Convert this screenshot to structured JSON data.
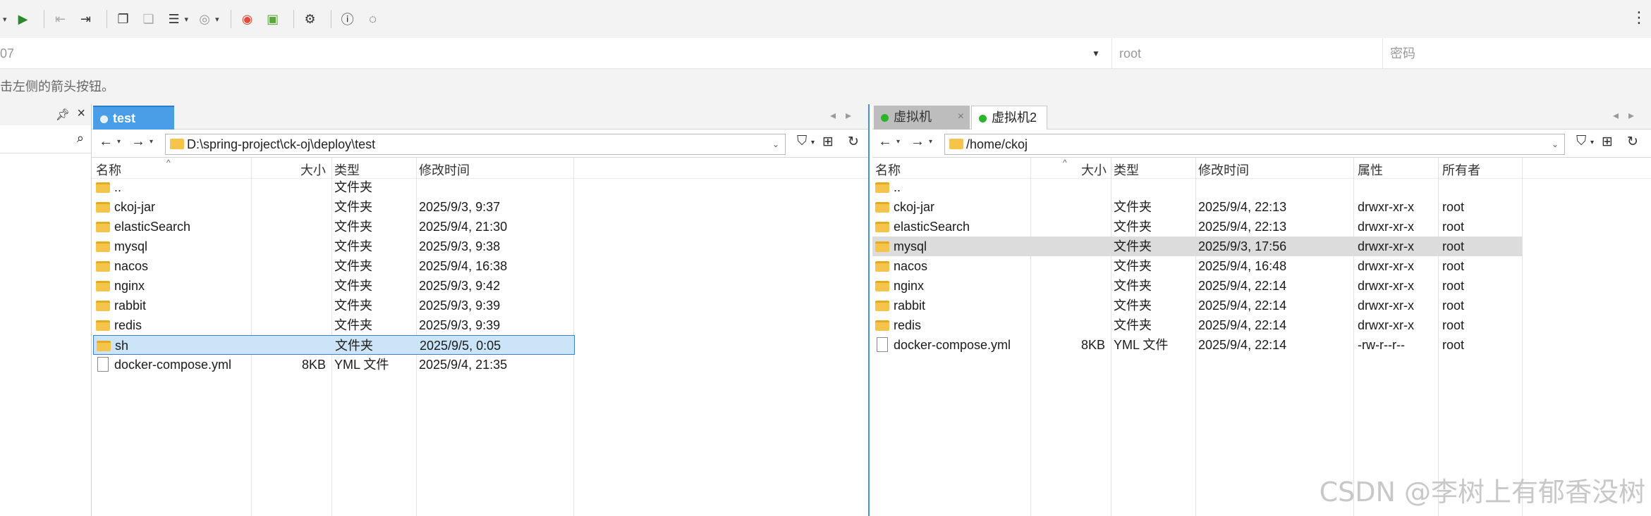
{
  "connection": {
    "host_fragment": "07",
    "user_placeholder": "root",
    "password_placeholder": "密码"
  },
  "hint": "击左侧的箭头按钮。",
  "local": {
    "tab_label": "test",
    "path": "D:\\spring-project\\ck-oj\\deploy\\test",
    "columns": {
      "name": "名称",
      "size": "大小",
      "type": "类型",
      "modified": "修改时间"
    },
    "rows": [
      {
        "name": "..",
        "size": "",
        "type": "文件夹",
        "modified": ""
      },
      {
        "name": "ckoj-jar",
        "size": "",
        "type": "文件夹",
        "modified": "2025/9/3, 9:37"
      },
      {
        "name": "elasticSearch",
        "size": "",
        "type": "文件夹",
        "modified": "2025/9/4, 21:30"
      },
      {
        "name": "mysql",
        "size": "",
        "type": "文件夹",
        "modified": "2025/9/3, 9:38"
      },
      {
        "name": "nacos",
        "size": "",
        "type": "文件夹",
        "modified": "2025/9/4, 16:38"
      },
      {
        "name": "nginx",
        "size": "",
        "type": "文件夹",
        "modified": "2025/9/3, 9:42"
      },
      {
        "name": "rabbit",
        "size": "",
        "type": "文件夹",
        "modified": "2025/9/3, 9:39"
      },
      {
        "name": "redis",
        "size": "",
        "type": "文件夹",
        "modified": "2025/9/3, 9:39"
      },
      {
        "name": "sh",
        "size": "",
        "type": "文件夹",
        "modified": "2025/9/5, 0:05"
      },
      {
        "name": "docker-compose.yml",
        "size": "8KB",
        "type": "YML 文件",
        "modified": "2025/9/4, 21:35"
      }
    ]
  },
  "remote": {
    "tabs": [
      {
        "label": "虚拟机"
      },
      {
        "label": "虚拟机2"
      }
    ],
    "path": "/home/ckoj",
    "columns": {
      "name": "名称",
      "size": "大小",
      "type": "类型",
      "modified": "修改时间",
      "perm": "属性",
      "owner": "所有者"
    },
    "rows": [
      {
        "name": "..",
        "size": "",
        "type": "",
        "modified": "",
        "perm": "",
        "owner": ""
      },
      {
        "name": "ckoj-jar",
        "size": "",
        "type": "文件夹",
        "modified": "2025/9/4, 22:13",
        "perm": "drwxr-xr-x",
        "owner": "root"
      },
      {
        "name": "elasticSearch",
        "size": "",
        "type": "文件夹",
        "modified": "2025/9/4, 22:13",
        "perm": "drwxr-xr-x",
        "owner": "root"
      },
      {
        "name": "mysql",
        "size": "",
        "type": "文件夹",
        "modified": "2025/9/3, 17:56",
        "perm": "drwxr-xr-x",
        "owner": "root"
      },
      {
        "name": "nacos",
        "size": "",
        "type": "文件夹",
        "modified": "2025/9/4, 16:48",
        "perm": "drwxr-xr-x",
        "owner": "root"
      },
      {
        "name": "nginx",
        "size": "",
        "type": "文件夹",
        "modified": "2025/9/4, 22:14",
        "perm": "drwxr-xr-x",
        "owner": "root"
      },
      {
        "name": "rabbit",
        "size": "",
        "type": "文件夹",
        "modified": "2025/9/4, 22:14",
        "perm": "drwxr-xr-x",
        "owner": "root"
      },
      {
        "name": "redis",
        "size": "",
        "type": "文件夹",
        "modified": "2025/9/4, 22:14",
        "perm": "drwxr-xr-x",
        "owner": "root"
      },
      {
        "name": "docker-compose.yml",
        "size": "8KB",
        "type": "YML 文件",
        "modified": "2025/9/4, 22:14",
        "perm": "-rw-r--r--",
        "owner": "root"
      }
    ]
  },
  "watermark": "CSDN @李树上有郁香没树"
}
